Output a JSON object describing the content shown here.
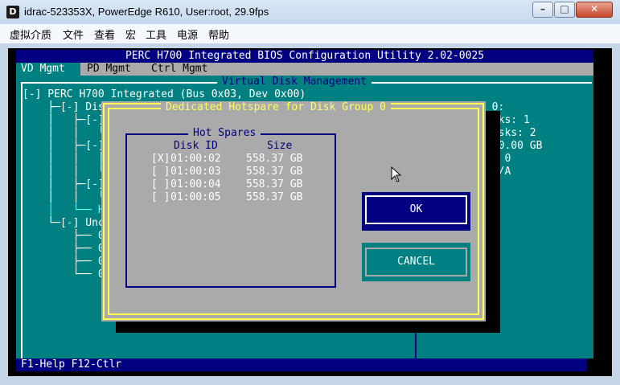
{
  "window": {
    "app_icon": "D",
    "title": "idrac-523353X, PowerEdge R610, User:root, 29.9fps",
    "controls": [
      "–",
      "□",
      "✕"
    ]
  },
  "menu": [
    "虚拟介质",
    "文件",
    "查看",
    "宏",
    "工具",
    "电源",
    "帮助"
  ],
  "bios": {
    "header": "PERC H700 Integrated BIOS Configuration Utility 2.02-0025",
    "tabs": [
      "VD Mgmt",
      "PD Mgmt",
      "Ctrl Mgmt"
    ],
    "panel_title": "Virtual Disk Management",
    "tree": [
      "[-] PERC H700 Integrated (Bus 0x03, Dev 0x00)",
      "    ├─[-] Disk",
      "    │   ├─[-] V",
      "    │   │   └──",
      "    │   ├─[-] P",
      "    │   │   ├──",
      "    │   │   └──",
      "    │   ├─[-] T",
      "    │   │   └──",
      "    │   └── Hot",
      "    └─[-] Unco",
      "        ├── 01:",
      "        ├── 01:",
      "        ├── 01:",
      "        └── 01:"
    ],
    "right_info": [
      "p 0:",
      "isks: 1",
      "Disks: 2",
      ": 0.00 GB",
      "s: 0",
      " N/A"
    ],
    "status": "F1-Help F12-Ctlr"
  },
  "dialog": {
    "title": "Dedicated Hotspare for Disk Group 0",
    "box_title": "Hot Spares",
    "col_disk": "Disk ID",
    "col_size": "Size",
    "rows": [
      {
        "check": "[X]",
        "disk": "01:00:02",
        "size": "558.37 GB"
      },
      {
        "check": "[ ]",
        "disk": "01:00:03",
        "size": "558.37 GB"
      },
      {
        "check": "[ ]",
        "disk": "01:00:04",
        "size": "558.37 GB"
      },
      {
        "check": "[ ]",
        "disk": "01:00:05",
        "size": "558.37 GB"
      }
    ],
    "ok_label": "OK",
    "cancel_label": "CANCEL"
  }
}
